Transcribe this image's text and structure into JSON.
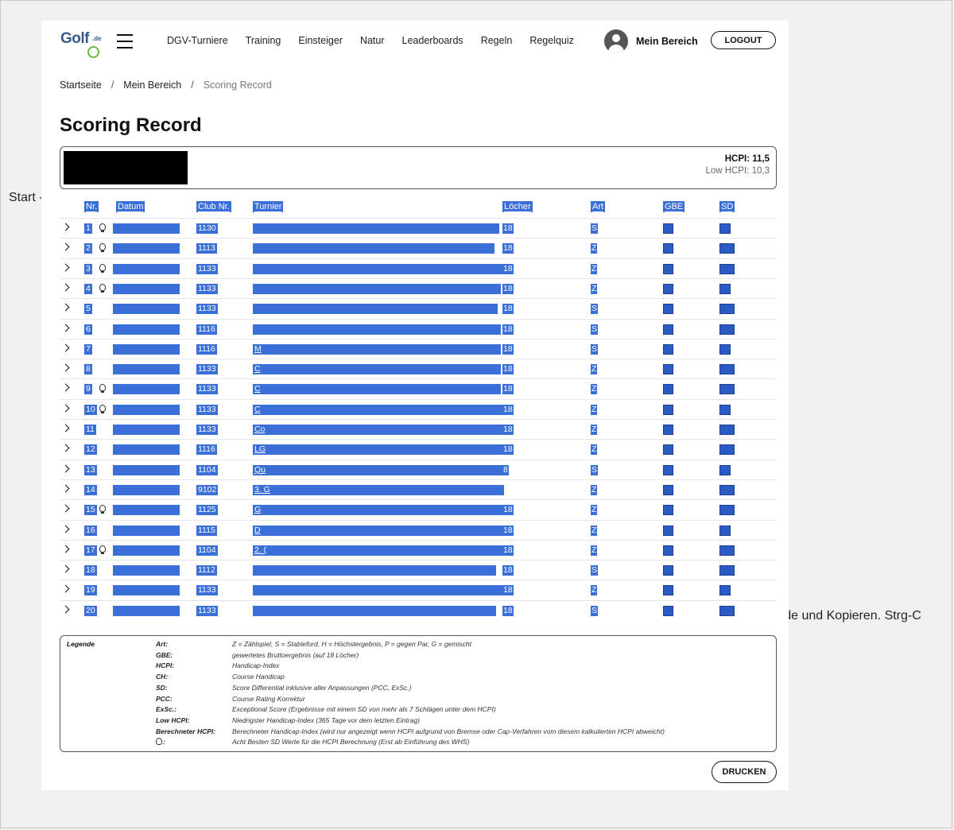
{
  "annotations": {
    "start": "Start ->",
    "end": "<-Ende und Kopieren. Strg-C"
  },
  "header": {
    "logo": "Golf",
    "logo_suffix": ".de",
    "nav": [
      "DGV-Turniere",
      "Training",
      "Einsteiger",
      "Natur",
      "Leaderboards",
      "Regeln",
      "Regelquiz"
    ],
    "account_label": "Mein Bereich",
    "logout_label": "LOGOUT"
  },
  "breadcrumb": [
    "Startseite",
    "Mein Bereich",
    "Scoring Record"
  ],
  "breadcrumb_separator": "/",
  "page_title": "Scoring Record",
  "profile": {
    "hcpi": "HCPI: 11,5",
    "low_hcpi": "Low HCPI: 10,3"
  },
  "table": {
    "columns": [
      "Nr.",
      "Datum",
      "Club Nr.",
      "Turnier",
      "Löcher",
      "Art",
      "GBE",
      "SD"
    ],
    "rows": [
      {
        "nr": "1",
        "bulb": true,
        "club": "1130",
        "turnier": "",
        "loecher": "18",
        "art": "S"
      },
      {
        "nr": "2",
        "bulb": true,
        "club": "1113",
        "turnier": "",
        "loecher": "18",
        "art": "Z"
      },
      {
        "nr": "3",
        "bulb": true,
        "club": "1133",
        "turnier": "",
        "loecher": "18",
        "art": "Z"
      },
      {
        "nr": "4",
        "bulb": true,
        "club": "1133",
        "turnier": "",
        "loecher": "18",
        "art": "Z"
      },
      {
        "nr": "5",
        "bulb": false,
        "club": "1133",
        "turnier": "",
        "loecher": "18",
        "art": "S"
      },
      {
        "nr": "6",
        "bulb": false,
        "club": "1116",
        "turnier": "",
        "loecher": "18",
        "art": "S"
      },
      {
        "nr": "7",
        "bulb": false,
        "club": "1116",
        "turnier": "M",
        "loecher": "18",
        "art": "S"
      },
      {
        "nr": "8",
        "bulb": false,
        "club": "1133",
        "turnier": "C",
        "loecher": "18",
        "art": "Z"
      },
      {
        "nr": "9",
        "bulb": true,
        "club": "1133",
        "turnier": "C",
        "loecher": "18",
        "art": "Z"
      },
      {
        "nr": "10",
        "bulb": true,
        "club": "1133",
        "turnier": "C",
        "loecher": "18",
        "art": "Z"
      },
      {
        "nr": "11",
        "bulb": false,
        "club": "1133",
        "turnier": "Co",
        "loecher": "18",
        "art": "Z"
      },
      {
        "nr": "12",
        "bulb": false,
        "club": "1116",
        "turnier": "LG",
        "loecher": "18",
        "art": "Z"
      },
      {
        "nr": "13",
        "bulb": false,
        "club": "1104",
        "turnier": "Qu",
        "loecher": "8",
        "art": "S"
      },
      {
        "nr": "14",
        "bulb": false,
        "club": "9102",
        "turnier": "3. G",
        "loecher": "",
        "art": "Z"
      },
      {
        "nr": "15",
        "bulb": true,
        "club": "1125",
        "turnier": "G",
        "loecher": "18",
        "art": "Z"
      },
      {
        "nr": "16",
        "bulb": false,
        "club": "1115",
        "turnier": "D",
        "loecher": "18",
        "art": "Z"
      },
      {
        "nr": "17",
        "bulb": true,
        "club": "1104",
        "turnier": "2. (",
        "loecher": "18",
        "art": "Z"
      },
      {
        "nr": "18",
        "bulb": false,
        "club": "1112",
        "turnier": "",
        "loecher": "18",
        "art": "S"
      },
      {
        "nr": "19",
        "bulb": false,
        "club": "1133",
        "turnier": "",
        "loecher": "18",
        "art": "Z"
      },
      {
        "nr": "20",
        "bulb": false,
        "club": "1133",
        "turnier": "",
        "loecher": "18",
        "art": "S"
      }
    ]
  },
  "legend": {
    "title": "Legende",
    "items": [
      {
        "term": "Art:",
        "def": "Z = Zählspiel, S = Stableford, H = Höchstergebnis, P = gegen Par, G = gemischt"
      },
      {
        "term": "GBE:",
        "def": "gewertetes Bruttoergebnis (auf 18 Löcher)"
      },
      {
        "term": "HCPI:",
        "def": "Handicap-Index"
      },
      {
        "term": "CH:",
        "def": "Course Handicap"
      },
      {
        "term": "SD:",
        "def": "Score Differential inklusive aller Anpassungen (PCC, ExSc.)"
      },
      {
        "term": "PCC:",
        "def": "Course Rating Korrektur"
      },
      {
        "term": "ExSc.:",
        "def": "Exceptional Score (Ergebnisse mit einem SD von mehr als 7 Schlägen unter dem HCPI)"
      },
      {
        "term": "Low HCPI:",
        "def": "Niedrigster Handicap-Index (365 Tage vor dem letzten Eintrag)"
      },
      {
        "term": "Berechneter HCPI:",
        "def": "Berechneter Handicap-Index (wird nur angezeigt wenn HCPI aufgrund von Bremse oder Cap-Verfahren vom diesem kalkulierten HCPI abweicht)"
      },
      {
        "term": ":",
        "def": "Acht Besten SD Werte für die HCPI Berechnung (Erst ab Einführung des WHS)"
      }
    ]
  },
  "print_label": "DRUCKEN",
  "colors": {
    "selection": "#3a6fd8",
    "accent_green": "#6dbb3c",
    "logo_blue": "#3a5a8a"
  }
}
